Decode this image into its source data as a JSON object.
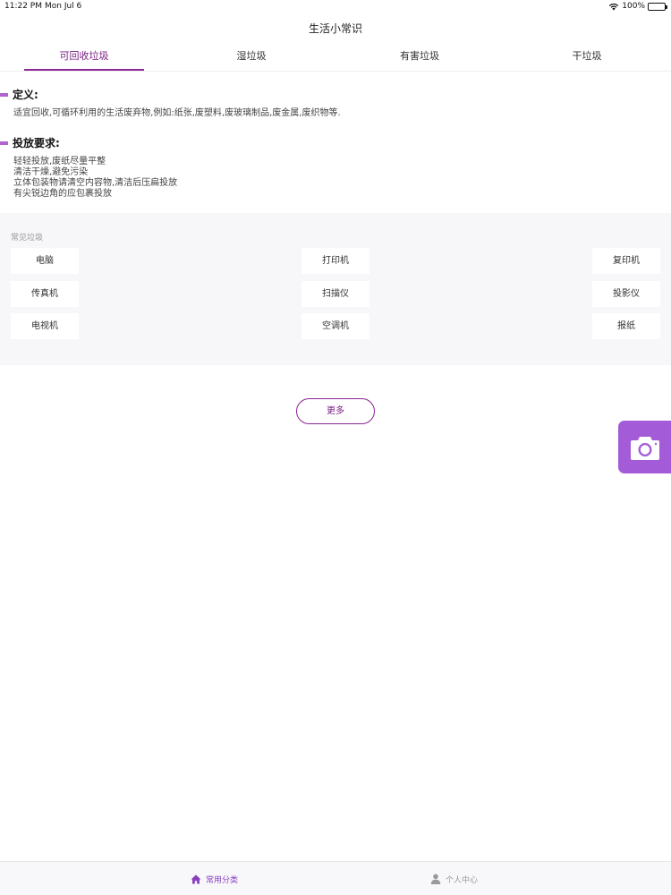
{
  "status_bar": {
    "time": "11:22 PM",
    "date": "Mon Jul 6",
    "battery": "100%"
  },
  "nav": {
    "title": "生活小常识"
  },
  "tabs": [
    {
      "label": "可回收垃圾",
      "active": true
    },
    {
      "label": "湿垃圾",
      "active": false
    },
    {
      "label": "有害垃圾",
      "active": false
    },
    {
      "label": "干垃圾",
      "active": false
    }
  ],
  "definition": {
    "title": "定义:",
    "text": "适宜回收,可循环利用的生活废弃物,例如:纸张,废塑料,废玻璃制品,废金属,废织物等."
  },
  "requirements": {
    "title": "投放要求:",
    "lines": [
      "轻轻投放,废纸尽量平整",
      "清洁干燥,避免污染",
      "立体包装物请清空内容物,清洁后压扁投放",
      "有尖锐边角的应包裹投放"
    ]
  },
  "common": {
    "title": "常见垃圾",
    "items": [
      "电脑",
      "打印机",
      "复印机",
      "传真机",
      "扫描仪",
      "投影仪",
      "电视机",
      "空调机",
      "报纸"
    ]
  },
  "more_label": "更多",
  "tabbar": [
    {
      "label": "常用分类",
      "icon": "home-icon",
      "active": true
    },
    {
      "label": "个人中心",
      "icon": "person-icon",
      "active": false
    }
  ],
  "colors": {
    "accent": "#8b2796",
    "camera": "#a35bd7",
    "section_bar": "#b063d0"
  }
}
